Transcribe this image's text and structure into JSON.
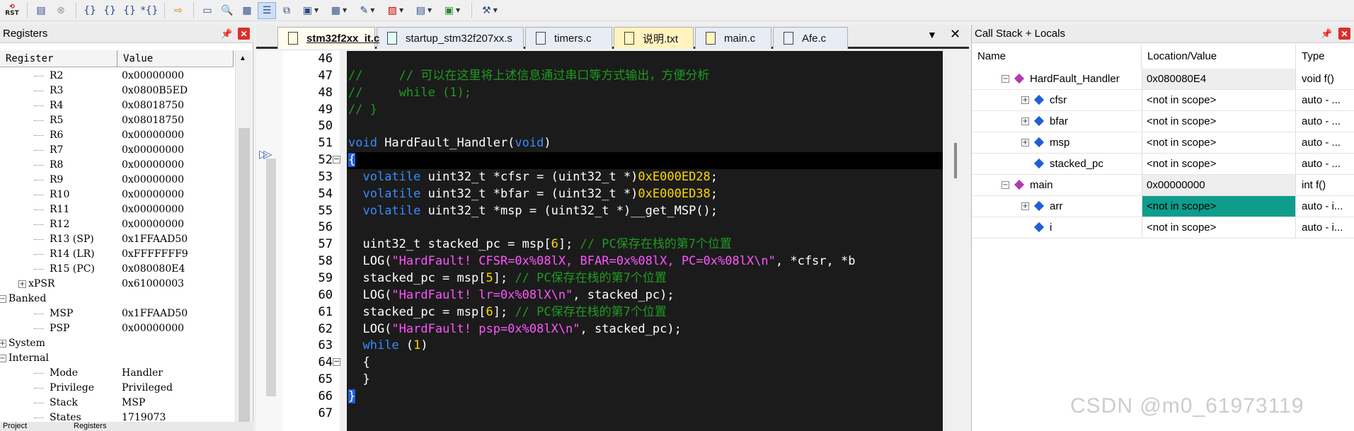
{
  "toolbar": {
    "rst_label": "RST"
  },
  "registers": {
    "title": "Registers",
    "col_register": "Register",
    "col_value": "Value",
    "rows": [
      {
        "name": "R2",
        "value": "0x00000000"
      },
      {
        "name": "R3",
        "value": "0x0800B5ED"
      },
      {
        "name": "R4",
        "value": "0x08018750"
      },
      {
        "name": "R5",
        "value": "0x08018750"
      },
      {
        "name": "R6",
        "value": "0x00000000"
      },
      {
        "name": "R7",
        "value": "0x00000000"
      },
      {
        "name": "R8",
        "value": "0x00000000"
      },
      {
        "name": "R9",
        "value": "0x00000000"
      },
      {
        "name": "R10",
        "value": "0x00000000"
      },
      {
        "name": "R11",
        "value": "0x00000000"
      },
      {
        "name": "R12",
        "value": "0x00000000"
      },
      {
        "name": "R13 (SP)",
        "value": "0x1FFAAD50"
      },
      {
        "name": "R14 (LR)",
        "value": "0xFFFFFFF9"
      },
      {
        "name": "R15 (PC)",
        "value": "0x080080E4"
      },
      {
        "name": "xPSR",
        "value": "0x61000003"
      },
      {
        "name": "Banked",
        "value": ""
      },
      {
        "name": "MSP",
        "value": "0x1FFAAD50"
      },
      {
        "name": "PSP",
        "value": "0x00000000"
      },
      {
        "name": "System",
        "value": ""
      },
      {
        "name": "Internal",
        "value": ""
      },
      {
        "name": "Mode",
        "value": "Handler"
      },
      {
        "name": "Privilege",
        "value": "Privileged"
      },
      {
        "name": "Stack",
        "value": "MSP"
      },
      {
        "name": "States",
        "value": "1719073"
      }
    ],
    "bottom_tab1": "Project",
    "bottom_tab2": "Registers"
  },
  "editor": {
    "tabs": [
      "stm32f2xx_it.c",
      "startup_stm32f207xx.s",
      "timers.c",
      "说明.txt",
      "main.c",
      "Afe.c"
    ],
    "active_tab": 0,
    "line_numbers": [
      "46",
      "47",
      "48",
      "49",
      "50",
      "51",
      "52",
      "53",
      "54",
      "55",
      "56",
      "57",
      "58",
      "59",
      "60",
      "61",
      "62",
      "63",
      "64",
      "65",
      "66",
      "67"
    ],
    "lines": [
      [],
      [
        [
          "cm",
          "//     // 可以在这里将上述信息通过串口等方式输出，方便分析"
        ]
      ],
      [
        [
          "cm",
          "//     while (1);"
        ]
      ],
      [
        [
          "cm",
          "// }"
        ]
      ],
      [],
      [
        [
          "kw",
          "void"
        ],
        [
          "tx",
          " HardFault_Handler("
        ],
        [
          "kw",
          "void"
        ],
        [
          "tx",
          ")"
        ]
      ],
      [
        [
          "tx",
          "{"
        ]
      ],
      [
        [
          "tx",
          "  "
        ],
        [
          "kw",
          "volatile"
        ],
        [
          "tx",
          " uint32_t *cfsr = (uint32_t *)"
        ],
        [
          "hx",
          "0xE000ED28"
        ],
        [
          "tx",
          ";"
        ]
      ],
      [
        [
          "tx",
          "  "
        ],
        [
          "kw",
          "volatile"
        ],
        [
          "tx",
          " uint32_t *bfar = (uint32_t *)"
        ],
        [
          "hx",
          "0xE000ED38"
        ],
        [
          "tx",
          ";"
        ]
      ],
      [
        [
          "tx",
          "  "
        ],
        [
          "kw",
          "volatile"
        ],
        [
          "tx",
          " uint32_t *msp = (uint32_t *)__get_MSP();"
        ]
      ],
      [],
      [
        [
          "tx",
          "  uint32_t stacked_pc = msp["
        ],
        [
          "hx",
          "6"
        ],
        [
          "tx",
          "]; "
        ],
        [
          "cm",
          "// PC保存在栈的第7个位置"
        ]
      ],
      [
        [
          "tx",
          "  LOG("
        ],
        [
          "st",
          "\"HardFault! CFSR=0x%08lX, BFAR=0x%08lX, PC=0x%08lX\\n\""
        ],
        [
          "tx",
          ", *cfsr, *b"
        ]
      ],
      [
        [
          "tx",
          "  stacked_pc = msp["
        ],
        [
          "hx",
          "5"
        ],
        [
          "tx",
          "]; "
        ],
        [
          "cm",
          "// PC保存在栈的第7个位置"
        ]
      ],
      [
        [
          "tx",
          "  LOG("
        ],
        [
          "st",
          "\"HardFault! lr=0x%08lX\\n\""
        ],
        [
          "tx",
          ", stacked_pc);"
        ]
      ],
      [
        [
          "tx",
          "  stacked_pc = msp["
        ],
        [
          "hx",
          "6"
        ],
        [
          "tx",
          "]; "
        ],
        [
          "cm",
          "// PC保存在栈的第7个位置"
        ]
      ],
      [
        [
          "tx",
          "  LOG("
        ],
        [
          "st",
          "\"HardFault! psp=0x%08lX\\n\""
        ],
        [
          "tx",
          ", stacked_pc);"
        ]
      ],
      [
        [
          "tx",
          "  "
        ],
        [
          "kw",
          "while"
        ],
        [
          "tx",
          " ("
        ],
        [
          "hx",
          "1"
        ],
        [
          "tx",
          ")"
        ]
      ],
      [
        [
          "tx",
          "  {"
        ]
      ],
      [
        [
          "tx",
          "  }"
        ]
      ],
      [
        [
          "tx",
          "}"
        ]
      ],
      []
    ]
  },
  "callstack": {
    "title": "Call Stack + Locals",
    "col_name": "Name",
    "col_location": "Location/Value",
    "col_type": "Type",
    "rows": [
      {
        "name": "HardFault_Handler",
        "value": "0x080080E4",
        "type": "void f()"
      },
      {
        "name": "cfsr",
        "value": "<not in scope>",
        "type": "auto - ..."
      },
      {
        "name": "bfar",
        "value": "<not in scope>",
        "type": "auto - ..."
      },
      {
        "name": "msp",
        "value": "<not in scope>",
        "type": "auto - ..."
      },
      {
        "name": "stacked_pc",
        "value": "<not in scope>",
        "type": "auto - ..."
      },
      {
        "name": "main",
        "value": "0x00000000",
        "type": "int f()"
      },
      {
        "name": "arr",
        "value": "<not in scope>",
        "type": "auto - i..."
      },
      {
        "name": "i",
        "value": "<not in scope>",
        "type": "auto - i..."
      }
    ]
  },
  "watermark": "CSDN @m0_61973119"
}
